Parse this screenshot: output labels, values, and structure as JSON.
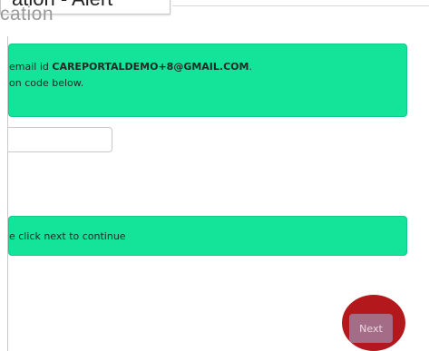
{
  "header": {
    "tooltip_text": "ation - Alert",
    "page_heading": "cation"
  },
  "verify_alert": {
    "prefix": "email id ",
    "email": "CAREPORTALDEMO+8@GMAIL.COM",
    "suffix": ".",
    "line2": "on code below."
  },
  "code_input": {
    "value": "",
    "placeholder": ""
  },
  "continue_alert": {
    "text": "e click next to continue"
  },
  "next_button": {
    "label": "Next"
  },
  "colors": {
    "alert_bg": "#14e39a",
    "next_button_bg": "#a46c86",
    "highlight_ring": "#b3191c"
  }
}
